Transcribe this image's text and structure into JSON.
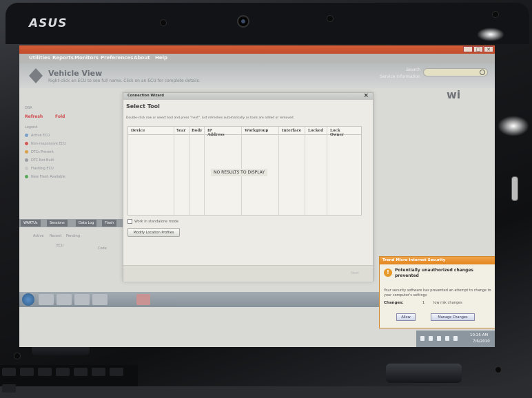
{
  "device": {
    "brand": "ASUS"
  },
  "app": {
    "title_bar_buttons": [
      "_",
      "□",
      "✕"
    ],
    "menu": [
      "Utilities",
      "Reports",
      "Monitors",
      "Preferences",
      "About",
      "Help"
    ],
    "title": "Vehicle View",
    "subtitle": "Right-click an ECU to see full name. Click on an ECU for complete details.",
    "search_label": "Search",
    "service_label": "Service Information",
    "search_placeholder": "",
    "logo_text": "wi",
    "left_panel": {
      "label_top": "DBA",
      "red_items": [
        "Refresh",
        "Fold"
      ],
      "legend_title": "Legend",
      "legend": [
        {
          "label": "Active ECU",
          "color": "#7aa0c8"
        },
        {
          "label": "Non-responsive ECU",
          "color": "#d45a5a"
        },
        {
          "label": "DTCs Present",
          "color": "#d9a04a"
        },
        {
          "label": "DTC Not Built",
          "color": "#9a9ea3"
        },
        {
          "label": "Flashing ECU",
          "color": "#c8c8c8"
        },
        {
          "label": "New Flash Available",
          "color": "#5aa85a"
        }
      ]
    },
    "bottom_tabs": [
      "WARTUs",
      "Sessions",
      "Data Log",
      "Flash"
    ],
    "lower_table": {
      "row1": [
        "Active",
        "Recent",
        "Pending"
      ],
      "row2": [
        "ECU",
        "Code"
      ]
    }
  },
  "dialog": {
    "window_title": "Connection Wizard",
    "heading": "Select Tool",
    "instructions": "Double-click row or select tool and press \"next\". List refreshes automatically as tools are added or removed.",
    "columns": [
      "Device",
      "Year",
      "Body",
      "IP Address",
      "Workgroup",
      "Interface",
      "Locked",
      "Lock Owner"
    ],
    "empty_message": "NO RESULTS TO DISPLAY",
    "standalone_label": "Work in standalone mode",
    "modify_button": "Modify Location Profiles",
    "next_button": "Next"
  },
  "notification": {
    "title": "Trend Micro Internet Security",
    "heading": "Potentially unauthorized changes prevented",
    "body": "Your security software has prevented an attempt to change to your computer's settings",
    "changes_label": "Changes:",
    "changes_count": "1",
    "risk_label": "low risk changes",
    "allow_button": "Allow",
    "manage_button": "Manage Changes"
  },
  "taskbar": {
    "time": "10:25 AM",
    "date": "7/6/2010"
  }
}
